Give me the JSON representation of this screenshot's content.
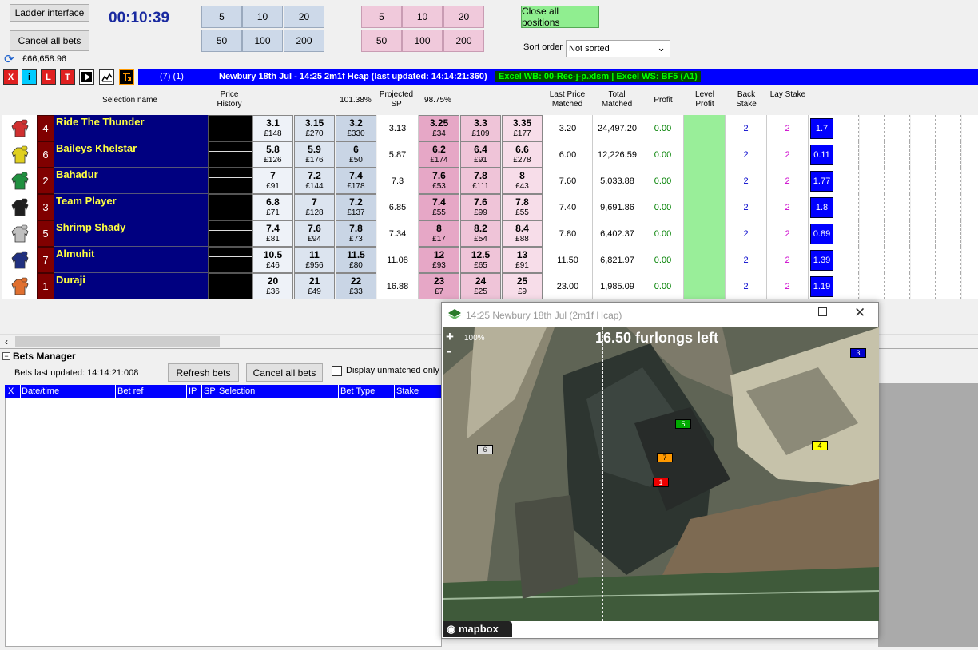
{
  "toolbar": {
    "ladder_btn": "Ladder interface",
    "cancel_all_btn": "Cancel all bets",
    "timer": "00:10:39",
    "balance": "£66,658.96",
    "back_stakes": [
      "5",
      "10",
      "20",
      "50",
      "100",
      "200"
    ],
    "lay_stakes": [
      "5",
      "10",
      "20",
      "50",
      "100",
      "200"
    ],
    "close_all_btn": "Close all positions",
    "sort_label": "Sort order",
    "sort_value": "Not sorted",
    "mini_buttons": [
      "X",
      "i",
      "L",
      "T"
    ],
    "market_count": "(7) (1)",
    "market_title": "Newbury 18th Jul - 14:25 2m1f Hcap (last updated: 14:14:21:360)",
    "excel_label": "Excel WB: 00-Rec-j-p.xlsm | Excel WS: BF5 (A1)"
  },
  "headers": {
    "selection": "Selection name",
    "price_history": "Price History",
    "back_book": "101.38%",
    "projected_sp": "Projected SP",
    "lay_book": "98.75%",
    "last_price": "Last Price Matched",
    "total_matched": "Total Matched",
    "profit": "Profit",
    "level_profit": "Level Profit",
    "back_stake": "Back Stake",
    "lay_stake": "Lay Stake"
  },
  "runners": [
    {
      "num": "4",
      "name": "Ride The Thunder",
      "silk": "#d03030",
      "b": [
        [
          "3.1",
          "£148"
        ],
        [
          "3.15",
          "£270"
        ],
        [
          "3.2",
          "£330"
        ]
      ],
      "sp": "3.13",
      "l": [
        [
          "3.25",
          "£34"
        ],
        [
          "3.3",
          "£109"
        ],
        [
          "3.35",
          "£177"
        ]
      ],
      "lpm": "3.20",
      "tm": "24,497.20",
      "profit": "0.00",
      "bs": "2",
      "ls": "2",
      "val": "1.7"
    },
    {
      "num": "6",
      "name": "Baileys Khelstar",
      "silk": "#e0d020",
      "b": [
        [
          "5.8",
          "£126"
        ],
        [
          "5.9",
          "£176"
        ],
        [
          "6",
          "£50"
        ]
      ],
      "sp": "5.87",
      "l": [
        [
          "6.2",
          "£174"
        ],
        [
          "6.4",
          "£91"
        ],
        [
          "6.6",
          "£278"
        ]
      ],
      "lpm": "6.00",
      "tm": "12,226.59",
      "profit": "0.00",
      "bs": "2",
      "ls": "2",
      "val": "0.11"
    },
    {
      "num": "2",
      "name": "Bahadur",
      "silk": "#209040",
      "b": [
        [
          "7",
          "£91"
        ],
        [
          "7.2",
          "£144"
        ],
        [
          "7.4",
          "£178"
        ]
      ],
      "sp": "7.3",
      "l": [
        [
          "7.6",
          "£53"
        ],
        [
          "7.8",
          "£111"
        ],
        [
          "8",
          "£43"
        ]
      ],
      "lpm": "7.60",
      "tm": "5,033.88",
      "profit": "0.00",
      "bs": "2",
      "ls": "2",
      "val": "1.77"
    },
    {
      "num": "3",
      "name": "Team Player",
      "silk": "#202020",
      "b": [
        [
          "6.8",
          "£71"
        ],
        [
          "7",
          "£128"
        ],
        [
          "7.2",
          "£137"
        ]
      ],
      "sp": "6.85",
      "l": [
        [
          "7.4",
          "£55"
        ],
        [
          "7.6",
          "£99"
        ],
        [
          "7.8",
          "£55"
        ]
      ],
      "lpm": "7.40",
      "tm": "9,691.86",
      "profit": "0.00",
      "bs": "2",
      "ls": "2",
      "val": "1.8"
    },
    {
      "num": "5",
      "name": "Shrimp Shady",
      "silk": "#c0c0c0",
      "b": [
        [
          "7.4",
          "£81"
        ],
        [
          "7.6",
          "£94"
        ],
        [
          "7.8",
          "£73"
        ]
      ],
      "sp": "7.34",
      "l": [
        [
          "8",
          "£17"
        ],
        [
          "8.2",
          "£54"
        ],
        [
          "8.4",
          "£88"
        ]
      ],
      "lpm": "7.80",
      "tm": "6,402.37",
      "profit": "0.00",
      "bs": "2",
      "ls": "2",
      "val": "0.89"
    },
    {
      "num": "7",
      "name": "Almuhit",
      "silk": "#203080",
      "b": [
        [
          "10.5",
          "£46"
        ],
        [
          "11",
          "£956"
        ],
        [
          "11.5",
          "£80"
        ]
      ],
      "sp": "11.08",
      "l": [
        [
          "12",
          "£93"
        ],
        [
          "12.5",
          "£65"
        ],
        [
          "13",
          "£91"
        ]
      ],
      "lpm": "11.50",
      "tm": "6,821.97",
      "profit": "0.00",
      "bs": "2",
      "ls": "2",
      "val": "1.39"
    },
    {
      "num": "1",
      "name": "Duraji",
      "silk": "#e07030",
      "b": [
        [
          "20",
          "£36"
        ],
        [
          "21",
          "£49"
        ],
        [
          "22",
          "£33"
        ]
      ],
      "sp": "16.88",
      "l": [
        [
          "23",
          "£7"
        ],
        [
          "24",
          "£25"
        ],
        [
          "25",
          "£9"
        ]
      ],
      "lpm": "23.00",
      "tm": "1,985.09",
      "profit": "0.00",
      "bs": "2",
      "ls": "2",
      "val": "1.19"
    }
  ],
  "bets": {
    "title": "Bets Manager",
    "last_updated": "Bets last updated: 14:14:21:008",
    "refresh_btn": "Refresh bets",
    "cancel_btn": "Cancel all bets",
    "unmatched_label": "Display unmatched only",
    "columns": [
      "X",
      "Date/time",
      "Bet ref",
      "IP",
      "SP",
      "Selection",
      "Bet Type",
      "Stake"
    ]
  },
  "map": {
    "title": "14:25 Newbury 18th Jul (2m1f Hcap)",
    "zoom": "100%",
    "plus": "+",
    "minus": "-",
    "furlongs": "16.50 furlongs left",
    "brand": "mapbox",
    "markers": [
      {
        "n": "3",
        "color": "#0000cc",
        "text": "#fff"
      },
      {
        "n": "5",
        "color": "#00aa00",
        "text": "#fff"
      },
      {
        "n": "4",
        "color": "#ffff00",
        "text": "#000"
      },
      {
        "n": "6",
        "color": "#dddddd",
        "text": "#333"
      },
      {
        "n": "7",
        "color": "#ff9900",
        "text": "#000"
      },
      {
        "n": "1",
        "color": "#ee0000",
        "text": "#fff"
      }
    ]
  }
}
